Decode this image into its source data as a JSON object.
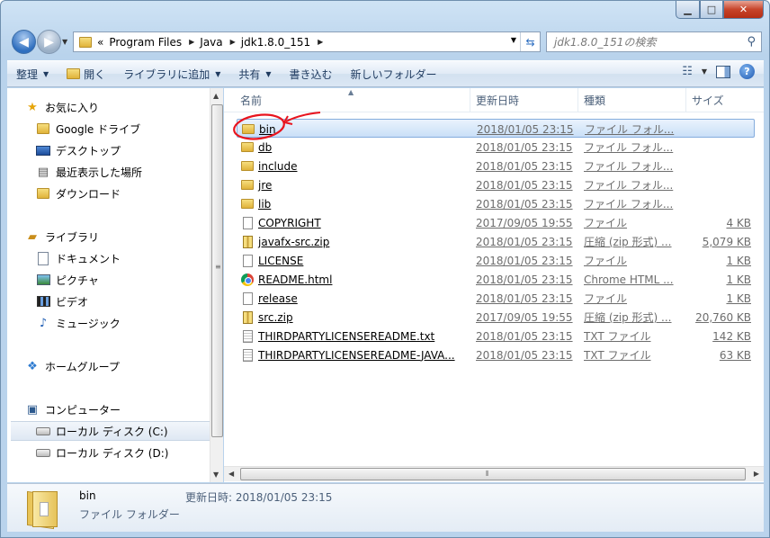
{
  "window": {
    "minimize": "▁",
    "maximize": "□",
    "close": "✕"
  },
  "address": {
    "overflow": "«",
    "crumbs": [
      "Program Files",
      "Java",
      "jdk1.8.0_151"
    ],
    "search_placeholder": "jdk1.8.0_151の検索"
  },
  "toolbar": {
    "organize": "整理",
    "open": "開く",
    "include_library": "ライブラリに追加",
    "share": "共有",
    "burn": "書き込む",
    "new_folder": "新しいフォルダー",
    "help": "?"
  },
  "nav": {
    "favorites": "お気に入り",
    "google_drive": "Google ドライブ",
    "desktop": "デスクトップ",
    "recent": "最近表示した場所",
    "downloads": "ダウンロード",
    "libraries": "ライブラリ",
    "documents": "ドキュメント",
    "pictures": "ピクチャ",
    "videos": "ビデオ",
    "music": "ミュージック",
    "homegroup": "ホームグループ",
    "computer": "コンピューター",
    "disk_c": "ローカル ディスク (C:)",
    "disk_d": "ローカル ディスク (D:)"
  },
  "columns": {
    "name": "名前",
    "date": "更新日時",
    "type": "種類",
    "size": "サイズ"
  },
  "files": [
    {
      "name": "bin",
      "date": "2018/01/05 23:15",
      "type": "ファイル フォル...",
      "size": "",
      "icon": "folder-icon"
    },
    {
      "name": "db",
      "date": "2018/01/05 23:15",
      "type": "ファイル フォル...",
      "size": "",
      "icon": "folder-icon"
    },
    {
      "name": "include",
      "date": "2018/01/05 23:15",
      "type": "ファイル フォル...",
      "size": "",
      "icon": "folder-icon"
    },
    {
      "name": "jre",
      "date": "2018/01/05 23:15",
      "type": "ファイル フォル...",
      "size": "",
      "icon": "folder-icon"
    },
    {
      "name": "lib",
      "date": "2018/01/05 23:15",
      "type": "ファイル フォル...",
      "size": "",
      "icon": "folder-icon"
    },
    {
      "name": "COPYRIGHT",
      "date": "2017/09/05 19:55",
      "type": "ファイル",
      "size": "4 KB",
      "icon": "file-icon"
    },
    {
      "name": "javafx-src.zip",
      "date": "2018/01/05 23:15",
      "type": "圧縮 (zip 形式) ...",
      "size": "5,079 KB",
      "icon": "zip-icon"
    },
    {
      "name": "LICENSE",
      "date": "2018/01/05 23:15",
      "type": "ファイル",
      "size": "1 KB",
      "icon": "file-icon"
    },
    {
      "name": "README.html",
      "date": "2018/01/05 23:15",
      "type": "Chrome HTML ...",
      "size": "1 KB",
      "icon": "chrome-icon"
    },
    {
      "name": "release",
      "date": "2018/01/05 23:15",
      "type": "ファイル",
      "size": "1 KB",
      "icon": "file-icon"
    },
    {
      "name": "src.zip",
      "date": "2017/09/05 19:55",
      "type": "圧縮 (zip 形式) ...",
      "size": "20,760 KB",
      "icon": "zip-icon"
    },
    {
      "name": "THIRDPARTYLICENSEREADME.txt",
      "date": "2018/01/05 23:15",
      "type": "TXT ファイル",
      "size": "142 KB",
      "icon": "text-file-icon"
    },
    {
      "name": "THIRDPARTYLICENSEREADME-JAVA...",
      "date": "2018/01/05 23:15",
      "type": "TXT ファイル",
      "size": "63 KB",
      "icon": "text-file-icon"
    }
  ],
  "details": {
    "name": "bin",
    "type": "ファイル フォルダー",
    "modified": "更新日時: 2018/01/05 23:15"
  },
  "colors": {
    "annotation": "#e8141e",
    "selection": "#c9dff7",
    "title_gradient": "#b9d3ec"
  }
}
